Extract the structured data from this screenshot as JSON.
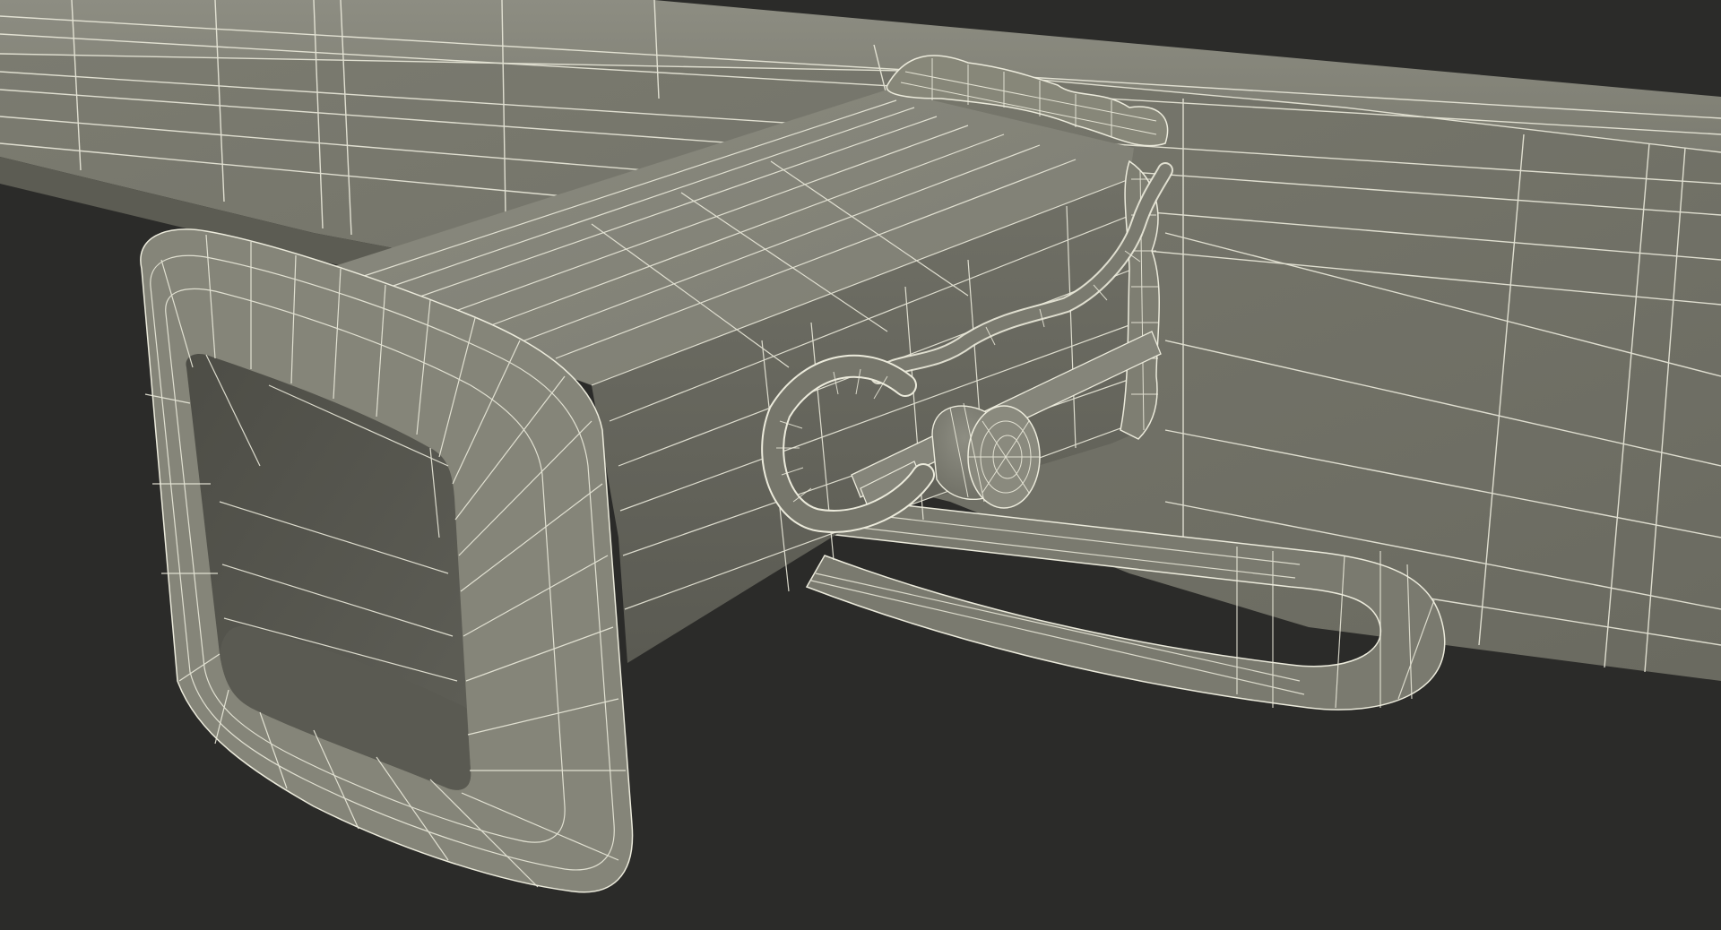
{
  "scene": {
    "subject_icon": "wireframe-render-icon",
    "colors": {
      "background": "#2b2b29",
      "surface_light": "#8a8a7f",
      "surface_mid": "#727267",
      "surface_dark": "#4e4e46",
      "interior": "#3f3f39",
      "wire": "#ecebdc"
    }
  }
}
